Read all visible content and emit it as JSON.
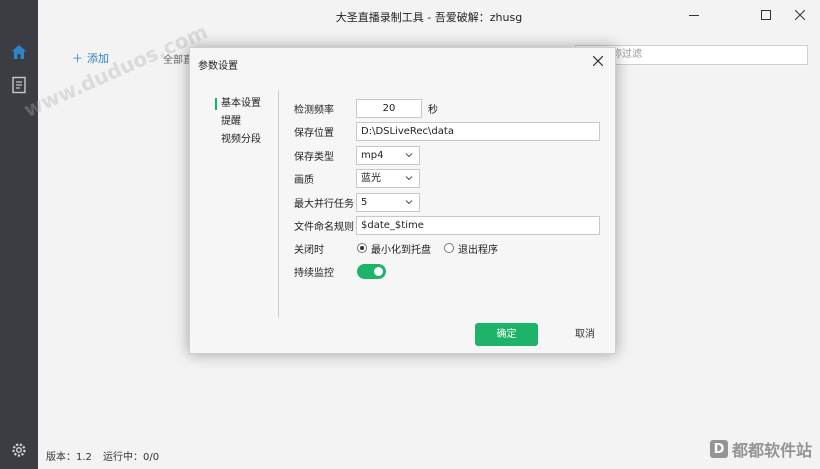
{
  "window": {
    "title": "大圣直播录制工具 - 吾爱破解：zhusg",
    "minimize_icon": "minimize-icon",
    "maximize_icon": "maximize-icon",
    "close_icon": "close-icon"
  },
  "sidebar": {
    "items": [
      {
        "icon": "home-icon",
        "color": "#2f83c9"
      },
      {
        "icon": "document-icon",
        "color": "#c9c9c9"
      }
    ],
    "settings_icon": "gear-icon"
  },
  "toolbar": {
    "add_label": "添加",
    "all_tab_label": "全部直",
    "filter_placeholder": "称过滤"
  },
  "status_bar": {
    "version": "版本：1.2",
    "running": "运行中：0/0"
  },
  "watermark": {
    "text": "www.duduos.com",
    "brand": "都都软件站"
  },
  "dialog": {
    "title": "参数设置",
    "nav": [
      "基本设置",
      "提醒",
      "视频分段"
    ],
    "active_nav": 0,
    "fields": {
      "interval": {
        "label": "检测频率",
        "value": "20",
        "unit": "秒"
      },
      "save_path": {
        "label": "保存位置",
        "value": "D:\\DSLiveRec\\data"
      },
      "save_type": {
        "label": "保存类型",
        "value": "mp4"
      },
      "quality": {
        "label": "画质",
        "value": "蓝光"
      },
      "max_tasks": {
        "label": "最大并行任务",
        "value": "5"
      },
      "naming_rule": {
        "label": "文件命名规则",
        "value": "$date_$time"
      },
      "on_close": {
        "label": "关闭时",
        "options": [
          "最小化到托盘",
          "退出程序"
        ],
        "selected": 0
      },
      "keep_monitor": {
        "label": "持续监控",
        "enabled": true
      }
    },
    "ok_label": "确定",
    "cancel_label": "取消"
  },
  "colors": {
    "accent_green": "#1db46a",
    "accent_blue": "#2f83c9",
    "sidebar_bg": "#3b3d42"
  }
}
